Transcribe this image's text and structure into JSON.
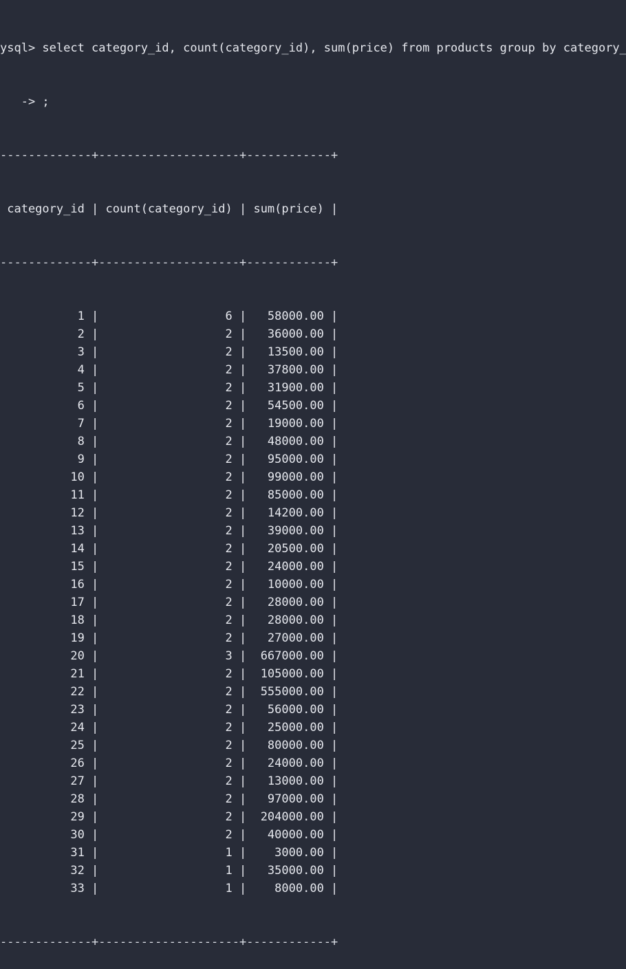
{
  "terminal": {
    "command_line": "ysql> select category_id, count(category_id), sum(price) from products group by category_id",
    "continuation_line": "   -> ;",
    "border": "-------------+--------------------+------------+",
    "header_line": " category_id | count(category_id) | sum(price) |",
    "columns": [
      "category_id",
      "count(category_id)",
      "sum(price)"
    ],
    "rows": [
      [
        "1",
        "6",
        "58000.00"
      ],
      [
        "2",
        "2",
        "36000.00"
      ],
      [
        "3",
        "2",
        "13500.00"
      ],
      [
        "4",
        "2",
        "37800.00"
      ],
      [
        "5",
        "2",
        "31900.00"
      ],
      [
        "6",
        "2",
        "54500.00"
      ],
      [
        "7",
        "2",
        "19000.00"
      ],
      [
        "8",
        "2",
        "48000.00"
      ],
      [
        "9",
        "2",
        "95000.00"
      ],
      [
        "10",
        "2",
        "99000.00"
      ],
      [
        "11",
        "2",
        "85000.00"
      ],
      [
        "12",
        "2",
        "14200.00"
      ],
      [
        "13",
        "2",
        "39000.00"
      ],
      [
        "14",
        "2",
        "20500.00"
      ],
      [
        "15",
        "2",
        "24000.00"
      ],
      [
        "16",
        "2",
        "10000.00"
      ],
      [
        "17",
        "2",
        "28000.00"
      ],
      [
        "18",
        "2",
        "28000.00"
      ],
      [
        "19",
        "2",
        "27000.00"
      ],
      [
        "20",
        "3",
        "667000.00"
      ],
      [
        "21",
        "2",
        "105000.00"
      ],
      [
        "22",
        "2",
        "555000.00"
      ],
      [
        "23",
        "2",
        "56000.00"
      ],
      [
        "24",
        "2",
        "25000.00"
      ],
      [
        "25",
        "2",
        "80000.00"
      ],
      [
        "26",
        "2",
        "24000.00"
      ],
      [
        "27",
        "2",
        "13000.00"
      ],
      [
        "28",
        "2",
        "97000.00"
      ],
      [
        "29",
        "2",
        "204000.00"
      ],
      [
        "30",
        "2",
        "40000.00"
      ],
      [
        "31",
        "1",
        "3000.00"
      ],
      [
        "32",
        "1",
        "35000.00"
      ],
      [
        "33",
        "1",
        "8000.00"
      ]
    ]
  },
  "colors": {
    "background": "#282c38",
    "text": "#e6e8ee"
  }
}
